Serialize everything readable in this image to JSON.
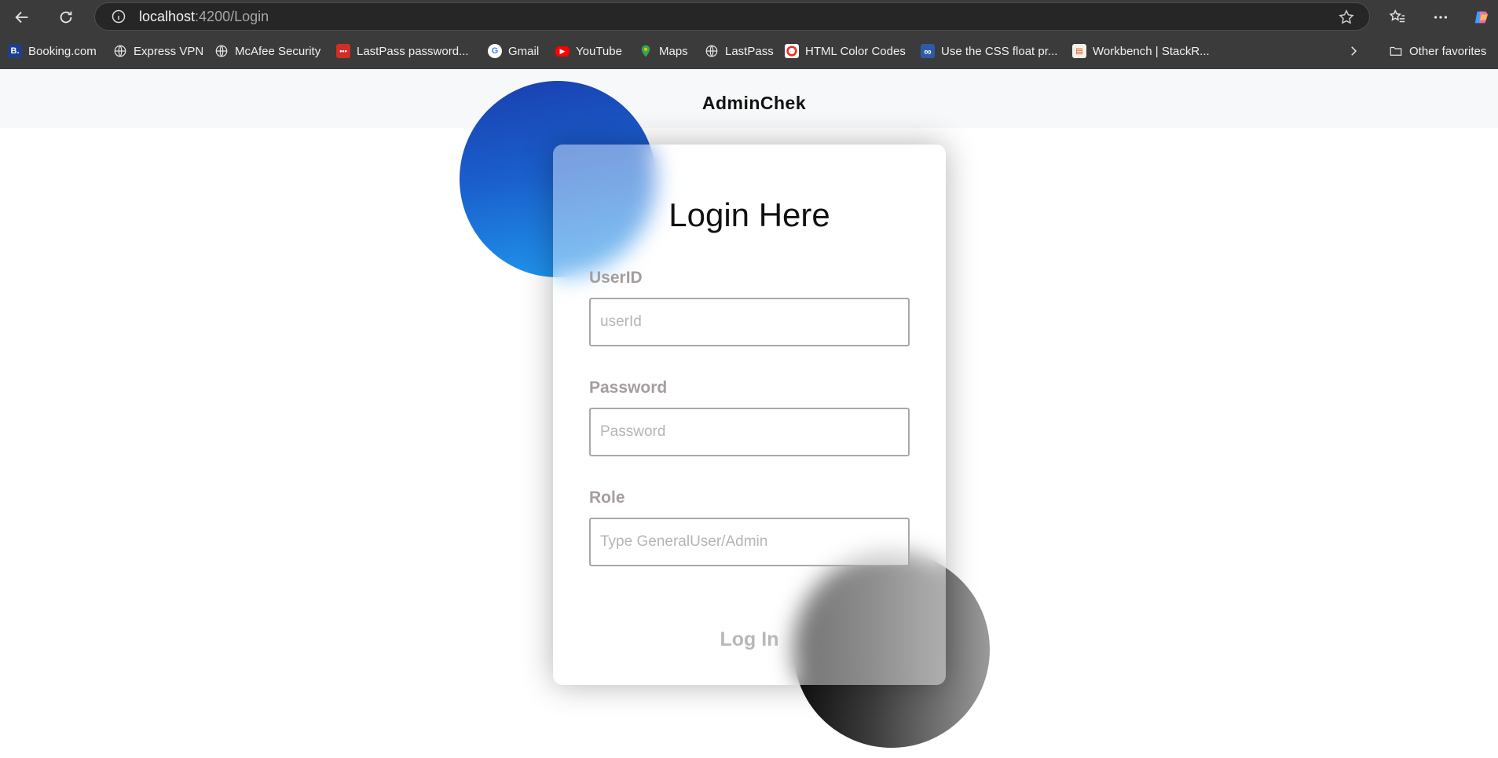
{
  "browser": {
    "url_host": "localhost",
    "url_path": ":4200/Login",
    "bookmarks": [
      {
        "label": "Booking.com",
        "icon": "booking-icon"
      },
      {
        "label": "Express VPN",
        "icon": "globe-icon"
      },
      {
        "label": "McAfee Security",
        "icon": "globe-icon"
      },
      {
        "label": "LastPass password...",
        "icon": "lastpass-icon"
      },
      {
        "label": "Gmail",
        "icon": "google-icon"
      },
      {
        "label": "YouTube",
        "icon": "youtube-icon"
      },
      {
        "label": "Maps",
        "icon": "maps-pin-icon"
      },
      {
        "label": "LastPass",
        "icon": "globe-icon"
      },
      {
        "label": "HTML Color Codes",
        "icon": "color-codes-icon"
      },
      {
        "label": "Use the CSS float pr...",
        "icon": "infinity-icon"
      },
      {
        "label": "Workbench | StackR...",
        "icon": "stackr-icon"
      }
    ],
    "other_favorites": "Other favorites"
  },
  "page": {
    "brand": "AdminChek",
    "form": {
      "title": "Login Here",
      "userid_label": "UserID",
      "userid_placeholder": "userId",
      "password_label": "Password",
      "password_placeholder": "Password",
      "role_label": "Role",
      "role_placeholder": "Type GeneralUser/Admin",
      "submit_label": "Log In"
    }
  },
  "colors": {
    "accent_blue": "#1a5ecc",
    "label_gray": "#a59e9e"
  }
}
